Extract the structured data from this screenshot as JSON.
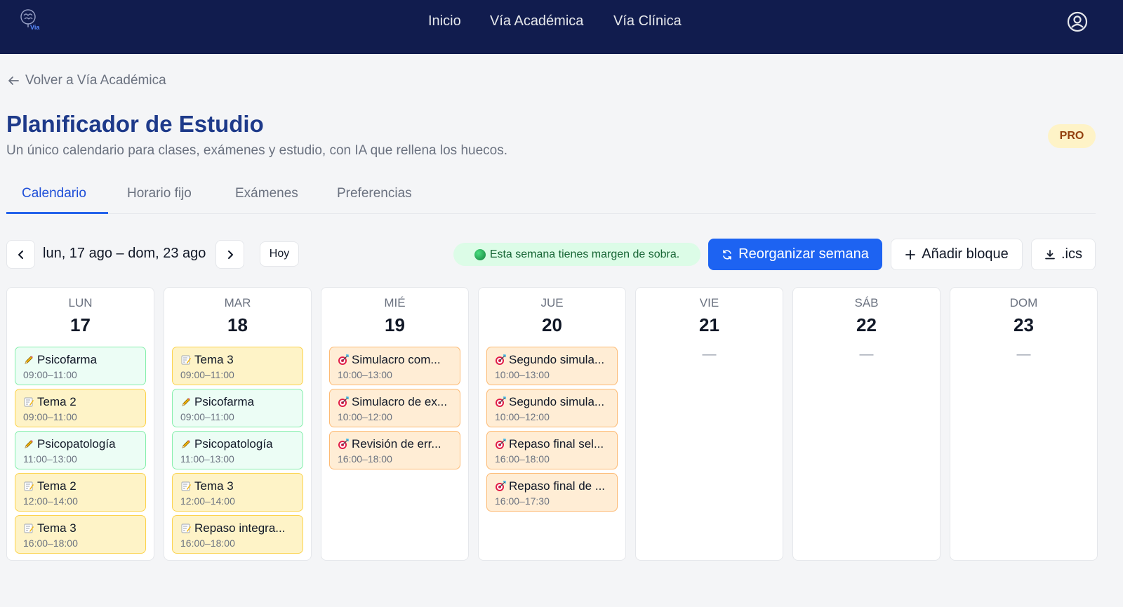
{
  "header": {
    "logo_text": "Via",
    "nav": [
      "Inicio",
      "Vía Académica",
      "Vía Clínica"
    ]
  },
  "back_label": "Volver a Vía Académica",
  "title": "Planificador de Estudio",
  "subtitle": "Un único calendario para clases, exámenes y estudio, con IA que rellena los huecos.",
  "badge": "PRO",
  "tabs": [
    "Calendario",
    "Horario fijo",
    "Exámenes",
    "Preferencias"
  ],
  "toolbar": {
    "range": "lun, 17 ago – dom, 23 ago",
    "today": "Hoy",
    "status": "Esta semana tienes margen de sobra.",
    "reorganize": "Reorganizar semana",
    "add_block": "Añadir bloque",
    "export": ".ics"
  },
  "days": [
    {
      "name": "LUN",
      "num": "17",
      "events": [
        {
          "icon": "pencil-icon",
          "title": "Psicofarma",
          "time": "09:00–11:00",
          "color": "green"
        },
        {
          "icon": "memo-icon",
          "title": "Tema 2",
          "time": "09:00–11:00",
          "color": "yellow"
        },
        {
          "icon": "pencil-icon",
          "title": "Psicopatología",
          "time": "11:00–13:00",
          "color": "green"
        },
        {
          "icon": "memo-icon",
          "title": "Tema 2",
          "time": "12:00–14:00",
          "color": "yellow"
        },
        {
          "icon": "memo-icon",
          "title": "Tema 3",
          "time": "16:00–18:00",
          "color": "yellow"
        }
      ]
    },
    {
      "name": "MAR",
      "num": "18",
      "events": [
        {
          "icon": "memo-icon",
          "title": "Tema 3",
          "time": "09:00–11:00",
          "color": "yellow"
        },
        {
          "icon": "pencil-icon",
          "title": "Psicofarma",
          "time": "09:00–11:00",
          "color": "green"
        },
        {
          "icon": "pencil-icon",
          "title": "Psicopatología",
          "time": "11:00–13:00",
          "color": "green"
        },
        {
          "icon": "memo-icon",
          "title": "Tema 3",
          "time": "12:00–14:00",
          "color": "yellow"
        },
        {
          "icon": "memo-icon",
          "title": "Repaso integra...",
          "time": "16:00–18:00",
          "color": "yellow"
        }
      ]
    },
    {
      "name": "MIÉ",
      "num": "19",
      "events": [
        {
          "icon": "target-icon",
          "title": "Simulacro com...",
          "time": "10:00–13:00",
          "color": "orange"
        },
        {
          "icon": "target-icon",
          "title": "Simulacro de ex...",
          "time": "10:00–12:00",
          "color": "orange"
        },
        {
          "icon": "target-icon",
          "title": "Revisión de err...",
          "time": "16:00–18:00",
          "color": "orange"
        }
      ]
    },
    {
      "name": "JUE",
      "num": "20",
      "events": [
        {
          "icon": "target-icon",
          "title": "Segundo simula...",
          "time": "10:00–13:00",
          "color": "orange"
        },
        {
          "icon": "target-icon",
          "title": "Segundo simula...",
          "time": "10:00–12:00",
          "color": "orange"
        },
        {
          "icon": "target-icon",
          "title": "Repaso final sel...",
          "time": "16:00–18:00",
          "color": "orange"
        },
        {
          "icon": "target-icon",
          "title": "Repaso final de ...",
          "time": "16:00–17:30",
          "color": "orange"
        }
      ]
    },
    {
      "name": "VIE",
      "num": "21",
      "empty": "—",
      "events": []
    },
    {
      "name": "SÁB",
      "num": "22",
      "empty": "—",
      "events": []
    },
    {
      "name": "DOM",
      "num": "23",
      "empty": "—",
      "events": []
    }
  ],
  "colors": {
    "header_bg": "#111c4e",
    "primary": "#1d63f2",
    "title": "#1e3a8a",
    "green_event": "#ecfdf5",
    "yellow_event": "#fef3c7",
    "orange_event": "#ffedd5"
  }
}
